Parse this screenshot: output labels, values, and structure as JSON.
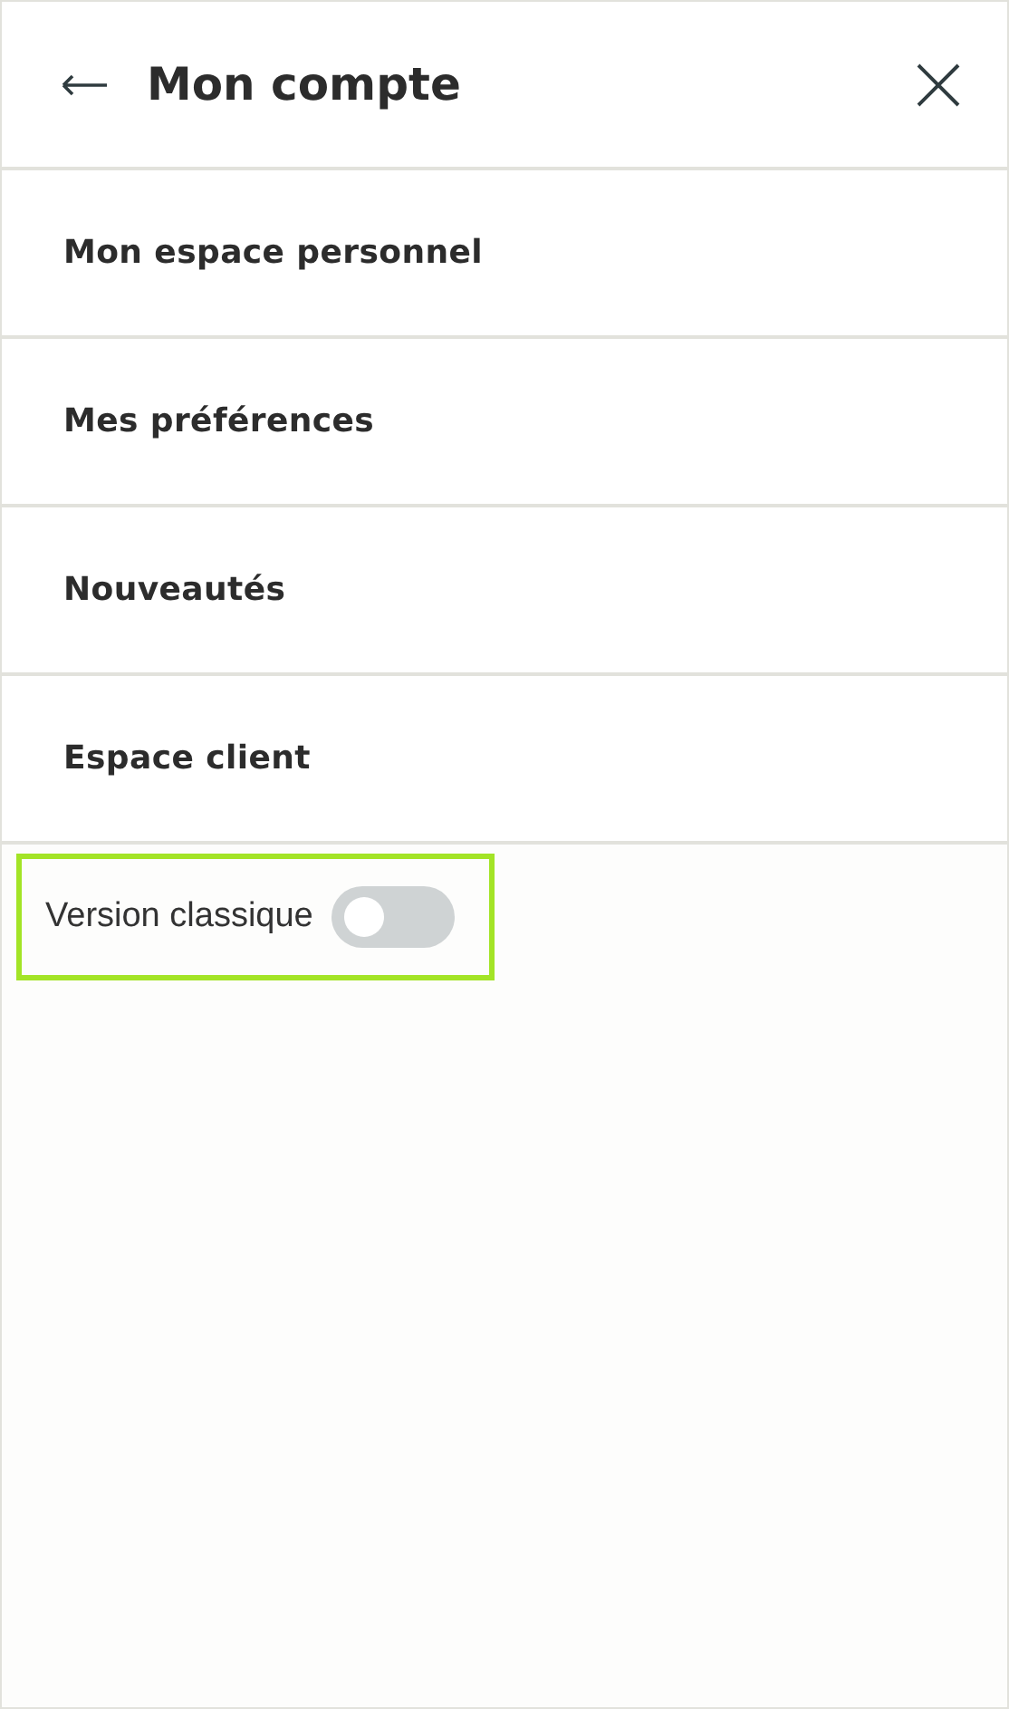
{
  "header": {
    "title": "Mon compte"
  },
  "menu_items": [
    {
      "label": "Mon espace personnel"
    },
    {
      "label": "Mes préférences"
    },
    {
      "label": "Nouveautés"
    },
    {
      "label": "Espace client"
    }
  ],
  "classic_version": {
    "label": "Version classique",
    "on": false,
    "highlighted": true
  }
}
